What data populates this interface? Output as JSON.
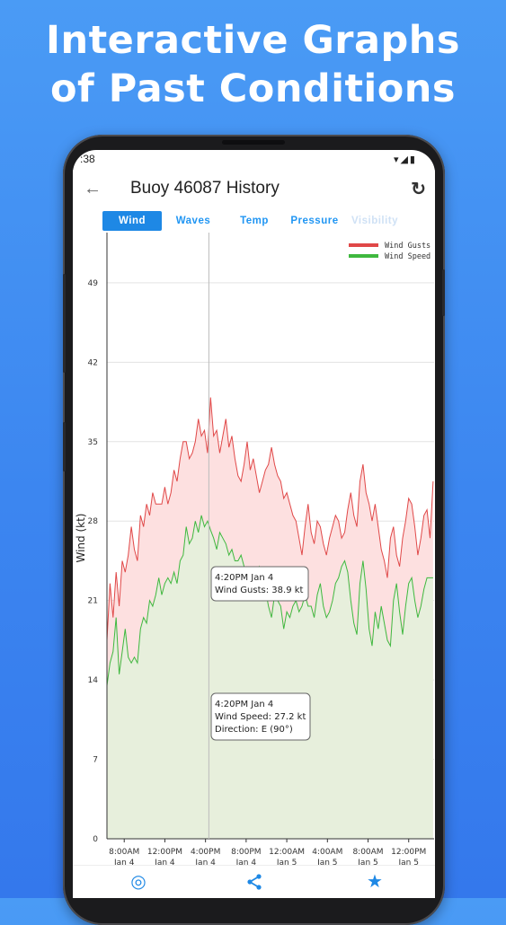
{
  "headline": {
    "line1": "Interactive Graphs",
    "line2": "of Past Conditions"
  },
  "status_bar": {
    "time": ":38",
    "icons": "▾◢▮"
  },
  "app_bar": {
    "title": "Buoy 46087 History",
    "back_icon": "arrow-left-icon",
    "refresh_icon": "refresh-icon"
  },
  "tabs": [
    {
      "label": "Wind",
      "active": true
    },
    {
      "label": "Waves",
      "active": false
    },
    {
      "label": "Temp",
      "active": false
    },
    {
      "label": "Pressure",
      "active": false
    },
    {
      "label": "Visibility",
      "active": false
    }
  ],
  "chart_data": {
    "type": "area",
    "ylabel": "Wind (kt)",
    "ylim": [
      0,
      52
    ],
    "yticks": [
      "0",
      "7",
      "14",
      "21",
      "28",
      "35",
      "42",
      "49"
    ],
    "xticks": [
      {
        "time": "8:00AM",
        "day": "Jan 4"
      },
      {
        "time": "12:00PM",
        "day": "Jan 4"
      },
      {
        "time": "4:00PM",
        "day": "Jan 4"
      },
      {
        "time": "8:00PM",
        "day": "Jan 4"
      },
      {
        "time": "12:00AM",
        "day": "Jan 5"
      },
      {
        "time": "4:00AM",
        "day": "Jan 5"
      },
      {
        "time": "8:00AM",
        "day": "Jan 5"
      },
      {
        "time": "12:00PM",
        "day": "Jan 5"
      }
    ],
    "x_hours_range": [
      6.3,
      38.5
    ],
    "grid": true,
    "legend_position": "top-right",
    "series": [
      {
        "name": "Wind Gusts",
        "color": "#e04848",
        "fill": "#fde0e0",
        "hours": [
          6.3,
          6.6,
          6.9,
          7.2,
          7.5,
          7.8,
          8.1,
          8.4,
          8.7,
          9.0,
          9.3,
          9.6,
          9.9,
          10.2,
          10.5,
          10.8,
          11.1,
          11.4,
          11.7,
          12.0,
          12.3,
          12.6,
          12.9,
          13.2,
          13.5,
          13.8,
          14.1,
          14.4,
          14.7,
          15.0,
          15.3,
          15.6,
          15.9,
          16.2,
          16.5,
          16.8,
          17.1,
          17.4,
          17.7,
          18.0,
          18.3,
          18.6,
          18.9,
          19.2,
          19.5,
          19.8,
          20.1,
          20.4,
          20.7,
          21.0,
          21.3,
          21.6,
          21.9,
          22.2,
          22.5,
          22.8,
          23.1,
          23.4,
          23.7,
          24.0,
          24.3,
          24.6,
          24.9,
          25.2,
          25.5,
          25.8,
          26.1,
          26.4,
          26.7,
          27.0,
          27.3,
          27.6,
          27.9,
          28.2,
          28.5,
          28.8,
          29.1,
          29.4,
          29.7,
          30.0,
          30.3,
          30.6,
          30.9,
          31.2,
          31.5,
          31.8,
          32.1,
          32.4,
          32.7,
          33.0,
          33.3,
          33.6,
          33.9,
          34.2,
          34.5,
          34.8,
          35.1,
          35.4,
          35.7,
          36.0,
          36.3,
          36.6,
          36.9,
          37.2,
          37.5,
          37.8,
          38.1,
          38.4
        ],
        "values": [
          17.5,
          22.5,
          19.5,
          23.5,
          20.5,
          24.5,
          23.5,
          25.0,
          27.5,
          25.5,
          24.5,
          28.5,
          27.5,
          29.5,
          28.5,
          30.5,
          29.5,
          29.5,
          29.5,
          31.0,
          29.5,
          30.5,
          32.5,
          31.5,
          33.5,
          35.0,
          35.0,
          33.5,
          34.0,
          35.0,
          37.0,
          35.5,
          36.0,
          34.0,
          38.9,
          35.5,
          36.0,
          34.0,
          35.5,
          37.0,
          34.5,
          35.5,
          33.5,
          32.0,
          31.5,
          33.0,
          35.0,
          32.5,
          33.5,
          32.0,
          30.5,
          31.5,
          32.5,
          33.0,
          34.5,
          33.0,
          32.0,
          31.5,
          30.0,
          30.5,
          29.5,
          28.5,
          28.0,
          26.5,
          25.0,
          27.5,
          29.5,
          27.0,
          26.0,
          28.0,
          27.5,
          26.0,
          25.0,
          26.5,
          27.5,
          28.5,
          28.0,
          26.5,
          27.0,
          29.0,
          30.5,
          28.5,
          27.5,
          31.5,
          33.0,
          30.5,
          29.5,
          28.0,
          29.5,
          27.5,
          25.5,
          24.5,
          23.0,
          26.5,
          27.5,
          25.0,
          24.0,
          26.5,
          28.0,
          30.0,
          29.5,
          27.5,
          25.0,
          26.5,
          28.5,
          29.0,
          26.5,
          31.5
        ]
      },
      {
        "name": "Wind Speed",
        "color": "#3fb83f",
        "fill": "#e7efdc",
        "hours": [
          6.3,
          6.6,
          6.9,
          7.2,
          7.5,
          7.8,
          8.1,
          8.4,
          8.7,
          9.0,
          9.3,
          9.6,
          9.9,
          10.2,
          10.5,
          10.8,
          11.1,
          11.4,
          11.7,
          12.0,
          12.3,
          12.6,
          12.9,
          13.2,
          13.5,
          13.8,
          14.1,
          14.4,
          14.7,
          15.0,
          15.3,
          15.6,
          15.9,
          16.2,
          16.5,
          16.8,
          17.1,
          17.4,
          17.7,
          18.0,
          18.3,
          18.6,
          18.9,
          19.2,
          19.5,
          19.8,
          20.1,
          20.4,
          20.7,
          21.0,
          21.3,
          21.6,
          21.9,
          22.2,
          22.5,
          22.8,
          23.1,
          23.4,
          23.7,
          24.0,
          24.3,
          24.6,
          24.9,
          25.2,
          25.5,
          25.8,
          26.1,
          26.4,
          26.7,
          27.0,
          27.3,
          27.6,
          27.9,
          28.2,
          28.5,
          28.8,
          29.1,
          29.4,
          29.7,
          30.0,
          30.3,
          30.6,
          30.9,
          31.2,
          31.5,
          31.8,
          32.1,
          32.4,
          32.7,
          33.0,
          33.3,
          33.6,
          33.9,
          34.2,
          34.5,
          34.8,
          35.1,
          35.4,
          35.7,
          36.0,
          36.3,
          36.6,
          36.9,
          37.2,
          37.5,
          37.8,
          38.1,
          38.4
        ],
        "values": [
          13.5,
          15.5,
          16.5,
          19.5,
          14.5,
          16.5,
          18.5,
          16.0,
          15.5,
          16.0,
          15.5,
          18.5,
          19.5,
          19.0,
          21.0,
          20.5,
          21.5,
          23.0,
          21.5,
          22.5,
          23.0,
          22.5,
          23.5,
          22.5,
          24.5,
          25.0,
          27.5,
          26.0,
          26.5,
          28.0,
          27.0,
          28.5,
          27.5,
          28.0,
          27.2,
          26.5,
          25.5,
          27.0,
          26.5,
          26.0,
          25.0,
          25.5,
          24.5,
          24.5,
          25.0,
          24.0,
          23.5,
          23.0,
          22.5,
          23.0,
          24.0,
          23.5,
          22.0,
          20.5,
          19.5,
          21.5,
          21.0,
          20.5,
          18.5,
          20.0,
          19.5,
          20.5,
          21.0,
          20.0,
          20.5,
          21.5,
          20.5,
          20.5,
          19.5,
          21.5,
          22.5,
          20.5,
          19.5,
          20.0,
          21.0,
          22.5,
          23.0,
          24.0,
          24.5,
          23.5,
          21.0,
          19.0,
          18.0,
          22.5,
          24.5,
          22.0,
          18.5,
          17.0,
          20.0,
          18.5,
          20.5,
          19.0,
          17.5,
          17.0,
          21.0,
          22.5,
          20.0,
          18.0,
          20.5,
          22.5,
          23.0,
          21.0,
          19.5,
          20.5,
          22.0,
          23.0,
          23.0,
          23.0
        ]
      }
    ],
    "cursor_hour": 16.33,
    "tooltips": [
      {
        "lines": [
          "4:20PM Jan 4",
          "Wind Gusts: 38.9 kt"
        ]
      },
      {
        "lines": [
          "4:20PM Jan 4",
          "Wind Speed: 27.2 kt",
          "Direction: E (90°)"
        ]
      }
    ]
  },
  "bottom_nav": [
    {
      "icon": "globe-pin-icon",
      "glyph": "◎"
    },
    {
      "icon": "share-icon",
      "glyph": "⋖"
    },
    {
      "icon": "star-icon",
      "glyph": "★"
    }
  ]
}
